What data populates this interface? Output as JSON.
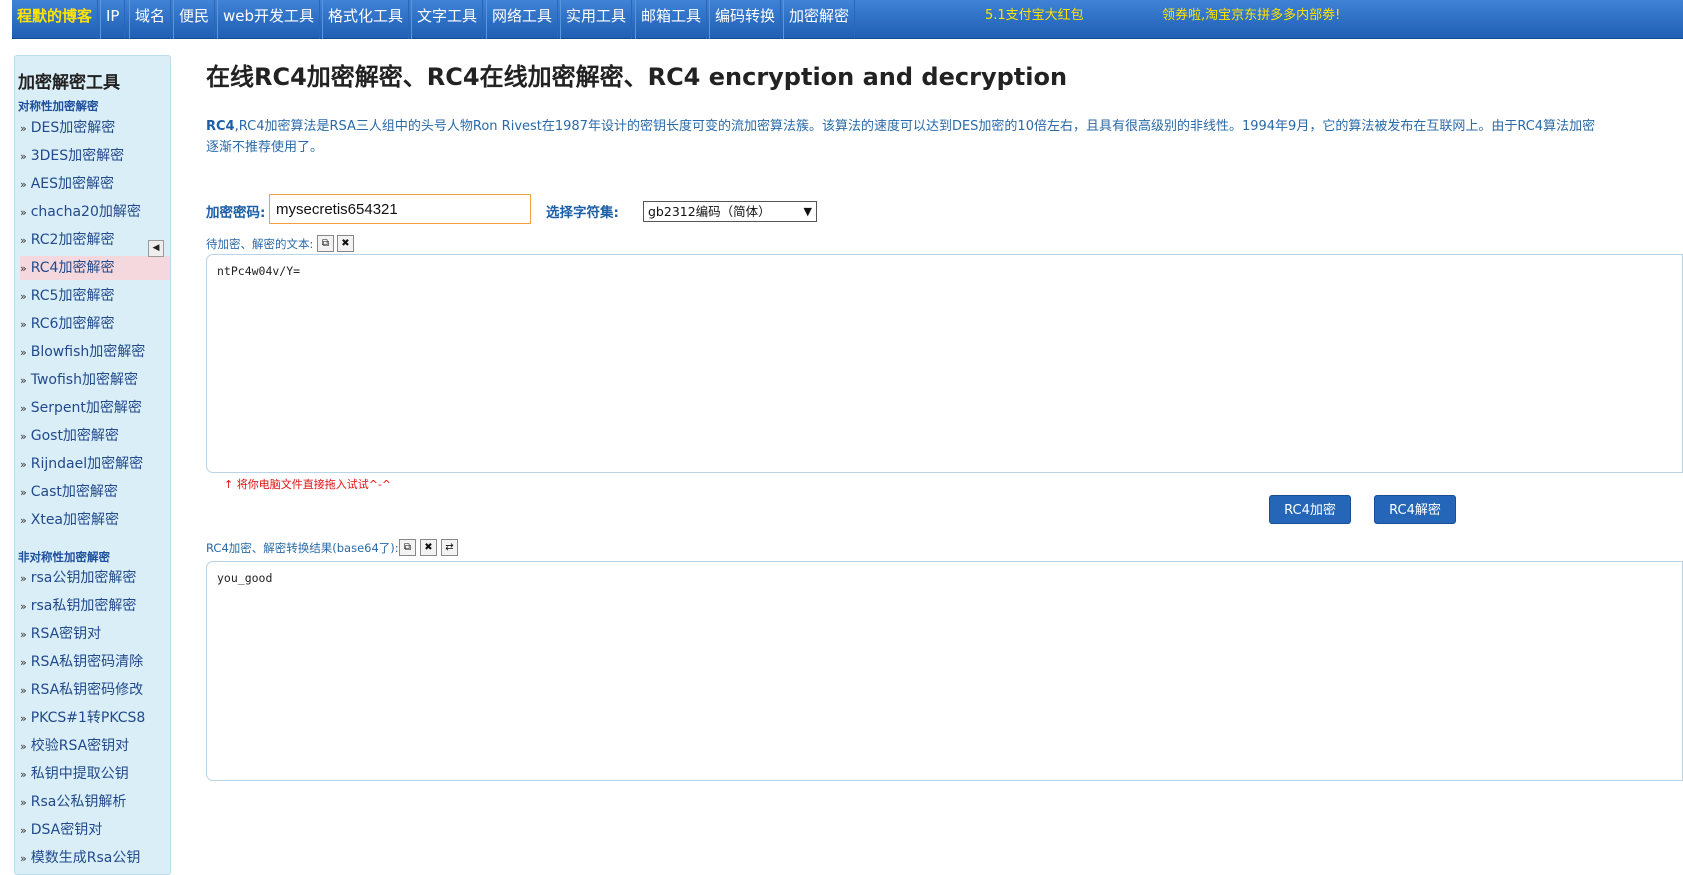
{
  "nav": {
    "brand": "程默的博客",
    "items": [
      "IP",
      "域名",
      "便民",
      "web开发工具",
      "格式化工具",
      "文字工具",
      "网络工具",
      "实用工具",
      "邮箱工具",
      "编码转换",
      "加密解密"
    ],
    "promo1": "5.1支付宝大红包",
    "promo2": "领券啦,淘宝京东拼多多内部劵!"
  },
  "sidebar": {
    "title": "加密解密工具",
    "section1": "对称性加密解密",
    "symmetric": [
      "DES加密解密",
      "3DES加密解密",
      "AES加密解密",
      "chacha20加解密",
      "RC2加密解密",
      "RC4加密解密",
      "RC5加密解密",
      "RC6加密解密",
      "Blowfish加密解密",
      "Twofish加密解密",
      "Serpent加密解密",
      "Gost加密解密",
      "Rijndael加密解密",
      "Cast加密解密",
      "Xtea加密解密"
    ],
    "section2": "非对称性加密解密",
    "asymmetric": [
      "rsa公钥加密解密",
      "rsa私钥加密解密",
      "RSA密钥对",
      "RSA私钥密码清除",
      "RSA私钥密码修改",
      "PKCS#1转PKCS8",
      "校验RSA密钥对",
      "私钥中提取公钥",
      "Rsa公私钥解析",
      "DSA密钥对",
      "模数生成Rsa公钥"
    ],
    "active": "RC4加密解密"
  },
  "main": {
    "title": "在线RC4加密解密、RC4在线加密解密、RC4 encryption and decryption",
    "desc_lead": "RC4",
    "desc_line1": ",RC4加密算法是RSA三人组中的头号人物Ron Rivest在1987年设计的密钥长度可变的流加密算法簇。该算法的速度可以达到DES加密的10倍左右，且具有很高级别的非线性。1994年9月，它的算法被发布在互联网上。由于RC4算法加密",
    "desc_line2": "逐渐不推荐使用了。",
    "key_label": "加密密码:",
    "key_value": "mysecretis654321",
    "charset_label": "选择字符集:",
    "charset_value": "gb2312编码（简体）",
    "input_label": "待加密、解密的文本:",
    "input_text": "ntPc4w04v/Y=",
    "hint": "↑ 将你电脑文件直接拖入试试^-^",
    "encrypt_btn": "RC4加密",
    "decrypt_btn": "RC4解密",
    "result_label": "RC4加密、解密转换结果(base64了):",
    "result_text": "you_good"
  }
}
